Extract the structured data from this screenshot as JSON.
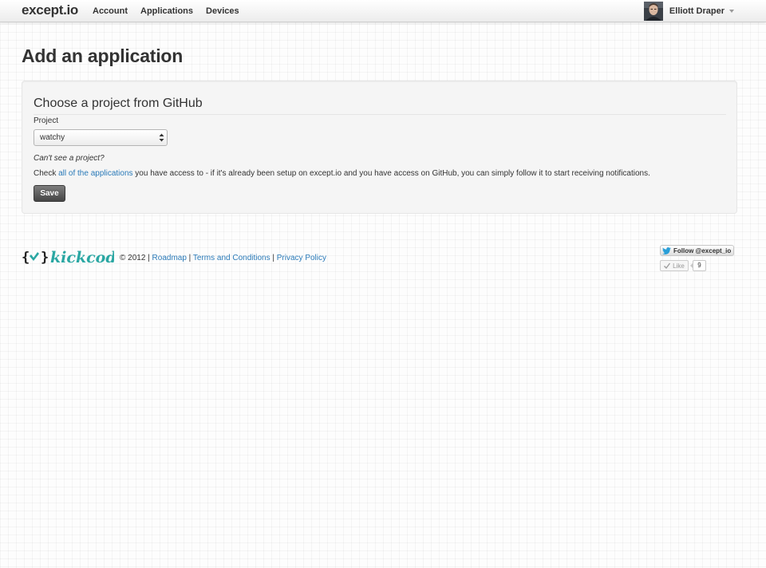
{
  "navbar": {
    "brand": "except.io",
    "items": [
      {
        "label": "Account"
      },
      {
        "label": "Applications"
      },
      {
        "label": "Devices"
      }
    ],
    "user": {
      "name": "Elliott Draper"
    }
  },
  "page": {
    "title": "Add an application"
  },
  "form": {
    "legend": "Choose a project from GitHub",
    "project_label": "Project",
    "project_selected": "watchy",
    "hint": "Can't see a project?",
    "help_before": "Check ",
    "help_link": "all of the applications",
    "help_after": " you have access to - if it's already been setup on except.io and you have access on GitHub, you can simply follow it to start receiving notifications.",
    "save_label": "Save"
  },
  "footer": {
    "logo_text": "kickcode",
    "copyright": "© 2012 | ",
    "links": [
      {
        "label": "Roadmap"
      },
      {
        "label": "Terms and Conditions"
      },
      {
        "label": "Privacy Policy"
      }
    ],
    "separator": " | ",
    "twitter_label": "Follow @except_io",
    "like_label": "Like",
    "like_count": "9"
  },
  "colors": {
    "link": "#2a7ab8",
    "logo_teal": "#2aa7a3",
    "save_button": "#4a4a4a",
    "twitter_blue": "#2a9fd8"
  }
}
